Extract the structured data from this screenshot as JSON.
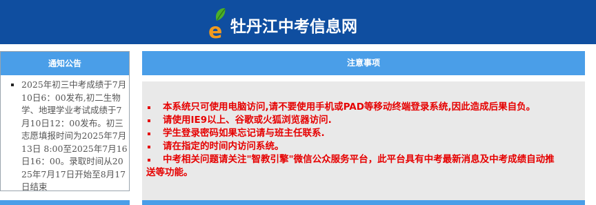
{
  "header": {
    "title": "牡丹江中考信息网",
    "logo_icon": "e-leaf-logo-icon",
    "colors": {
      "background": "#0f4ea0",
      "logo_green": "#4caf2a",
      "logo_orange": "#f29a1f"
    }
  },
  "notice_panel": {
    "title": "通知公告",
    "items": [
      "2025年初三中考成绩于7月10日6：00发布,初二生物学、地理学业考试成绩于7月10日12：00发布。初三志愿填报时间为2025年7月13日 8:00至2025年7月16日16：00。录取时间从2025年7月17日开始至8月17日结束"
    ]
  },
  "main_panel": {
    "title": "注意事项",
    "rules": [
      "本系统只可使用电脑访问,请不要使用手机或PAD等移动终端登录系统,因此造成后果自负。",
      "请使用IE9以上、谷歌或火狐浏览器访问.",
      "学生登录密码如果忘记请与班主任联系.",
      "请在指定的时间内访问系统。",
      "中考相关问题请关注\"智教引擎\"微信公众服务平台，此平台具有中考最新消息及中考成绩自动推送等功能。"
    ]
  },
  "colors": {
    "panel_header": "#4a9ee8",
    "rule_text": "#e60000",
    "body_bg": "#e9e9e9"
  }
}
